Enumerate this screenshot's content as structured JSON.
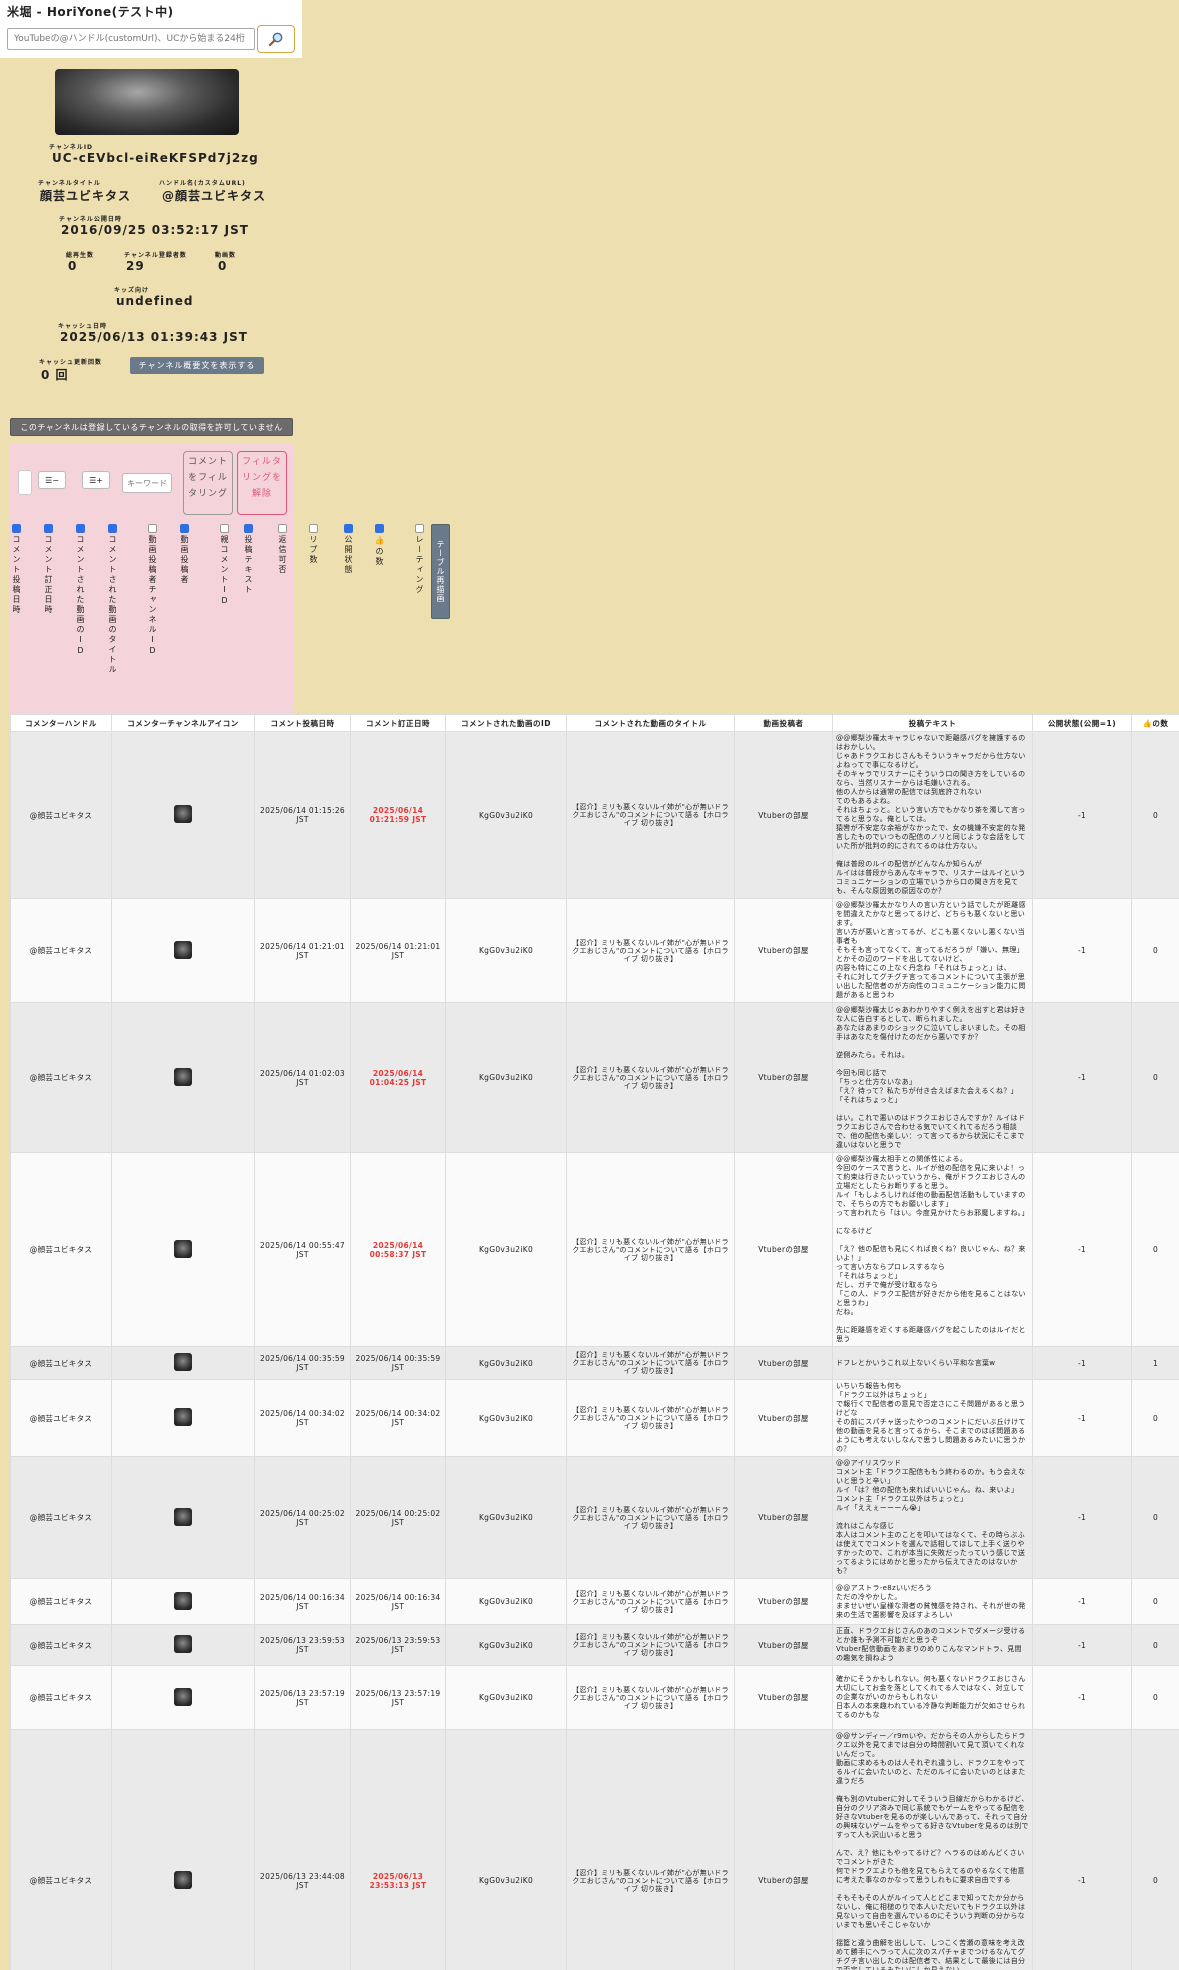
{
  "app": {
    "title": "米堀 - HoriYone(テスト中)"
  },
  "search": {
    "placeholder": "YouTubeの@ハンドル(customUrl)、UCから始まる24桁"
  },
  "channel": {
    "id_label": "チャンネルID",
    "id": "UC-cEVbcl-eiReKFSPd7j2zg",
    "title_label": "チャンネルタイトル",
    "title": "顔芸ユビキタス",
    "handle_label": "ハンドル名(カスタムURL)",
    "handle": "@顔芸ユビキタス",
    "published_label": "チャンネル公開日時",
    "published": "2016/09/25 03:52:17 JST",
    "views_label": "総再生数",
    "views": "0",
    "subs_label": "チャンネル登録者数",
    "subs": "29",
    "videos_label": "動画数",
    "videos": "0",
    "kids_label": "キッズ向け",
    "kids": "undefined",
    "cache_label": "キャッシュ日時",
    "cache": "2025/06/13 01:39:43 JST",
    "cache_count_label": "キャッシュ更新回数",
    "cache_count": "0 回",
    "desc_button": "チャンネル概要文を表示する"
  },
  "notice": "このチャンネルは登録しているチャンネルの取得を許可していません",
  "filter": {
    "minus_label": "☰−",
    "plus_label": "☰+",
    "keyword_placeholder": "キーワード",
    "apply_label": "コメントをフィルタリング",
    "clear_label": "フィルタリングを解除",
    "redraw_label": "テーブル再描画",
    "columns": [
      {
        "label": "コメント投稿日時",
        "checked": true
      },
      {
        "label": "コメント訂正日時",
        "checked": true
      },
      {
        "label": "コメントされた動画のID",
        "checked": true
      },
      {
        "label": "コメントされた動画のタイトル",
        "checked": true
      },
      {
        "label": "動画投稿者チャンネルID",
        "checked": false
      },
      {
        "label": "動画投稿者",
        "checked": true
      },
      {
        "label": "親コメントID",
        "checked": false
      },
      {
        "label": "投稿テキスト",
        "checked": true
      },
      {
        "label": "返信可否",
        "checked": false
      },
      {
        "label": "リプ数",
        "checked": false
      },
      {
        "label": "公開状態",
        "checked": true
      },
      {
        "label": "👍の数",
        "checked": true
      },
      {
        "label": "レーティング",
        "checked": false
      }
    ]
  },
  "table": {
    "headers": [
      "コメンターハンドル",
      "コメンターチャンネルアイコン",
      "コメント投稿日時",
      "コメント訂正日時",
      "コメントされた動画のID",
      "コメントされた動画のタイトル",
      "動画投稿者",
      "投稿テキスト",
      "公開状態(公開=1)",
      "👍の数"
    ],
    "rows": [
      {
        "handle": "@顔芸ユビキタス",
        "posted": "2025/06/14 01:15:26 JST",
        "edited": "2025/06/14 01:21:59 JST",
        "video_id": "KgG0v3u2iK0",
        "video_title": "【忍介】ミリも悪くないルイ姉が\"心が無いドラクエおじさん\"のコメントについて語る【ホロライブ 切り抜き】",
        "uploader": "Vtuberの部屋",
        "text": "@@郷梨沙羅太キャラじゃないで距離感バグを擁護するのはおかしい。\nじゃあドラクエおじさんもそういうキャラだから仕方ないよねってで事になるけど。\nそのキャラでリスナーにそういう口の聞き方をしているのなら、当然リスナーからは毛嫌いされる。\n他の人からは通常の配信では到底許されない\nてのもあるよね。\nそれはちょっと。という言い方でもかなり茶を濁して言ってると思うな。俺としては。\n猿轡が不安定な余裕がなかったで、女の機嫌不安定的な発言したものでいつもの配信のノリと同じような会話をしていた所が批判の的にされてるのは仕方ない。\n\n俺は普段のルイの配信がどんなんか知らんが\nルイはは普段からあんなキャラで、リスナーはルイというコミュニケーションの立場でいうから口の聞き方を見ても、そんな原因気の原因なのか？",
        "status": "-1",
        "likes": "0",
        "edited_flag": true,
        "h": 158
      },
      {
        "handle": "@顔芸ユビキタス",
        "posted": "2025/06/14 01:21:01 JST",
        "edited": "2025/06/14 01:21:01 JST",
        "video_id": "KgG0v3u2iK0",
        "video_title": "【忍介】ミリも悪くないルイ姉が\"心が無いドラクエおじさん\"のコメントについて語る【ホロライブ 切り抜き】",
        "uploader": "Vtuberの部屋",
        "text": "@@郷梨沙羅太かなり人の言い方という話でしたが距離感を間違えたかなと思ってるけど、どちらも悪くないと思います。\n言い方が悪いと言ってるが、どこも悪くないし悪くない当事者も\nそもそも言ってなくて、言ってるだろうが「嫌い、無理」とかその辺のワードを出してないけど、\n内容も特にこの上なく丹念ね「それはちょっと」は、\nそれに対してグチグチ言ってるコメントについて主張が思い出した配信者のが方向性のコミュニケーション能力に問題があると思うわ",
        "status": "-1",
        "likes": "0",
        "edited_flag": false,
        "h": 101
      },
      {
        "handle": "@顔芸ユビキタス",
        "posted": "2025/06/14 01:02:03 JST",
        "edited": "2025/06/14 01:04:25 JST",
        "video_id": "KgG0v3u2iK0",
        "video_title": "【忍介】ミリも悪くないルイ姉が\"心が無いドラクエおじさん\"のコメントについて語る【ホロライブ 切り抜き】",
        "uploader": "Vtuberの部屋",
        "text": "@@郷梨沙羅太じゃあわかりやすく例えを出すと君は好きな人に告白するとして、断られました。\nあなたはあまりのショックに泣いてしまいました。その相手はあなたを傷付けたのだから悪いですか？\n\n逆側みたら。それは。\n\n今回も同じ話で\n「ちっと仕方ないなあ」\n「え？待って？私たちが付き合えばまた会えるくね？」\n「それはちょっと」\n\nはい。これで悪いのはドラクエおじさんですか？ルイはドラクエおじさんで合わせる気でいてくれてるだろう相談で、他の配信も楽しい：って言ってるから状況にそこまで違いはないと思うで",
        "status": "-1",
        "likes": "0",
        "edited_flag": true,
        "h": 150
      },
      {
        "handle": "@顔芸ユビキタス",
        "posted": "2025/06/14 00:55:47 JST",
        "edited": "2025/06/14 00:58:37 JST",
        "video_id": "KgG0v3u2iK0",
        "video_title": "【忍介】ミリも悪くないルイ姉が\"心が無いドラクエおじさん\"のコメントについて語る【ホロライブ 切り抜き】",
        "uploader": "Vtuberの部屋",
        "text": "@@郷梨沙羅太相手との関係性による。\n今回のケースで言うと、ルイが他の配信を見に来いよ！って約束は行きたいっていうから、俺がドラクエおじさんの立場だとしたらお断りすると思う。\nルイ「もしよろしければ他の動画配信活動もしていますので、そちらの方でもお願いします」\nって言われたら「はい。今度見かけたらお邪魔しますね。」\n\nになるけど\n\n「え？他の配信も見にくれば良くね？良いじゃん、ね？来いよ！」\nって言い方ならプロレスするなら\n「それはちょっと」\nだし、ガチで俺が受け取るなら\n「この人、ドラクエ配信が好きだから他を見ることはないと思うわ」\nだね。\n\n先に距離感を近くする距離感バグを起こしたのはルイだと思う",
        "status": "-1",
        "likes": "0",
        "edited_flag": true,
        "h": 186
      },
      {
        "handle": "@顔芸ユビキタス",
        "posted": "2025/06/14 00:35:59 JST",
        "edited": "2025/06/14 00:35:59 JST",
        "video_id": "KgG0v3u2iK0",
        "video_title": "【忍介】ミリも悪くないルイ姉が\"心が無いドラクエおじさん\"のコメントについて語る【ホロライブ 切り抜き】",
        "uploader": "Vtuberの部屋",
        "text": "ドフレとかいうこれ以上ないくらい平和な言葉w",
        "status": "-1",
        "likes": "1",
        "edited_flag": false,
        "h": 33
      },
      {
        "handle": "@顔芸ユビキタス",
        "posted": "2025/06/14 00:34:02 JST",
        "edited": "2025/06/14 00:34:02 JST",
        "video_id": "KgG0v3u2iK0",
        "video_title": "【忍介】ミリも悪くないルイ姉が\"心が無いドラクエおじさん\"のコメントについて語る【ホロライブ 切り抜き】",
        "uploader": "Vtuberの部屋",
        "text": "いちいち報告も何も\n「ドラクエ以外はちょっと」\nで報行くで配信者の意見で否定さにこそ問題があると思うけどな\nその前にスパチャ送ったやつのコメントにだいぶ丘けけて他の動画を見ると言ってるから、そこまでのほぼ問題あるようにも考えないしなんで思うし問題あるみたいに思うかの？",
        "status": "-1",
        "likes": "0",
        "edited_flag": false,
        "h": 64
      },
      {
        "handle": "@顔芸ユビキタス",
        "posted": "2025/06/14 00:25:02 JST",
        "edited": "2025/06/14 00:25:02 JST",
        "video_id": "KgG0v3u2iK0",
        "video_title": "【忍介】ミリも悪くないルイ姉が\"心が無いドラクエおじさん\"のコメントについて語る【ホロライブ 切り抜き】",
        "uploader": "Vtuberの部屋",
        "text": "@@アイリスウッド\nコメント主「ドラクエ配信ももう終わるのか。もう会えないと思うと辛い」\nルイ「は？他の配信も来ればいいじゃん。ね、来いよ」\nコメント主「ドラクエ以外はちょっと」\nルイ「ええぇーーーん😭」\n\n流れはこんな感じ\n本人はコメント主のことを叩いてはなくて、その時らぶふは使えてでコメントを選んで話相してほして上手く送りやすかったので、これが本当に失敗だったっていう感じで送ってるようにはめかと思ったから伝えてきたのはないかも？",
        "status": "-1",
        "likes": "0",
        "edited_flag": false,
        "h": 118
      },
      {
        "handle": "@顔芸ユビキタス",
        "posted": "2025/06/14 00:16:34 JST",
        "edited": "2025/06/14 00:16:34 JST",
        "video_id": "KgG0v3u2iK0",
        "video_title": "【忍介】ミリも悪くないルイ姉が\"心が無いドラクエおじさん\"のコメントについて語る【ホロライブ 切り抜き】",
        "uploader": "Vtuberの部屋",
        "text": "@@アストラ-e8zいいだろう\nただの冷やかした。\nまませいぜい皇様な滑者の貧愧感を持され、それが世の発来の生活で悪影響を及ぼすよろしい",
        "status": "-1",
        "likes": "0",
        "edited_flag": false,
        "h": 46
      },
      {
        "handle": "@顔芸ユビキタス",
        "posted": "2025/06/13 23:59:53 JST",
        "edited": "2025/06/13 23:59:53 JST",
        "video_id": "KgG0v3u2iK0",
        "video_title": "【忍介】ミリも悪くないルイ姉が\"心が無いドラクエおじさん\"のコメントについて語る【ホロライブ 切り抜き】",
        "uploader": "Vtuberの部屋",
        "text": "正直、ドラクエおじさんのあのコメントでダメージ受けるとか誰も予測不可能だと思うぞ\nVtuber配信動画をあまりのめりこんなマンドトラ、見間の趣気を損ねよう",
        "status": "-1",
        "likes": "0",
        "edited_flag": false,
        "h": 34
      },
      {
        "handle": "@顔芸ユビキタス",
        "posted": "2025/06/13 23:57:19 JST",
        "edited": "2025/06/13 23:57:19 JST",
        "video_id": "KgG0v3u2iK0",
        "video_title": "【忍介】ミリも悪くないルイ姉が\"心が無いドラクエおじさん\"のコメントについて語る【ホロライブ 切り抜き】",
        "uploader": "Vtuberの部屋",
        "text": "確かにそうかもしれない。何も悪くないドラクエおじさん大切にしてお金を落としてくれてる人ではなく、対立しての企業ながいのからもしれない\n日本人の本来趣われている冷静な判断能力が欠如させられてるのかもな",
        "status": "-1",
        "likes": "0",
        "edited_flag": false,
        "h": 64
      },
      {
        "handle": "@顔芸ユビキタス",
        "posted": "2025/06/13 23:44:08 JST",
        "edited": "2025/06/13 23:53:13 JST",
        "video_id": "KgG0v3u2iK0",
        "video_title": "【忍介】ミリも悪くないルイ姉が\"心が無いドラクエおじさん\"のコメントについて語る【ホロライブ 切り抜き】",
        "uploader": "Vtuberの部屋",
        "text": "@@サンディー／r9mいや、だからその人からしたらドラクエ以外を見てまでは自分の時間割いて見て頂いてくれないんだって。\n動画に求めるものは人それぞれ違うし、ドラクエをやってるルイに会いたいのと、ただのルイに会いたいのとはまた違うだろ\n\n俺も別のVtuberに対してそういう目線だからわかるけど、自分のクリア済みで同じ系統でもゲームをやってる配信を好きなVtuberを見るのが楽しいんであって、それって自分の興味ないゲームをやってる好きなVtuberを見るのは別ですって人も沢山いると思う\n\nんで、え？他にもやってるけど？ヘラるのはめんどくさいでコメントがきた\n何でドラクエよりも他を見てもらえてるのやるなくて他意に考えた事なのかなって思うしれもに要求自由でする\n\nそもそもその人がルイって人とどこまで知ってたか分からないし、俺に相槌のりで本人いただいてもドラクエ以外は見ないって自由を選んでいるのにそういう判断の分からないまでも思いそこじゃないか\n\n揺籃と違う曲解を出しして、しつこく苦瀬の意味を考え改めて勝手にヘラって人に次のスパチャまでつけるなんてグチグチ言い出したのは配信者で、結果として最後には自分で否定しているみたいにしか見えない\n\n(本人は疲れていたと言ってるけど、疲れてもそれがあなた特殊のかもしれないけど。なんで急にグチグチ言ってる人ではいつもしてはないのにそれを前に出すかどうかは僕は分からないけどまた自分の判断を正当化するのってアリなのかなと)",
        "status": "-1",
        "likes": "0",
        "edited_flag": true,
        "h": 290
      }
    ]
  }
}
